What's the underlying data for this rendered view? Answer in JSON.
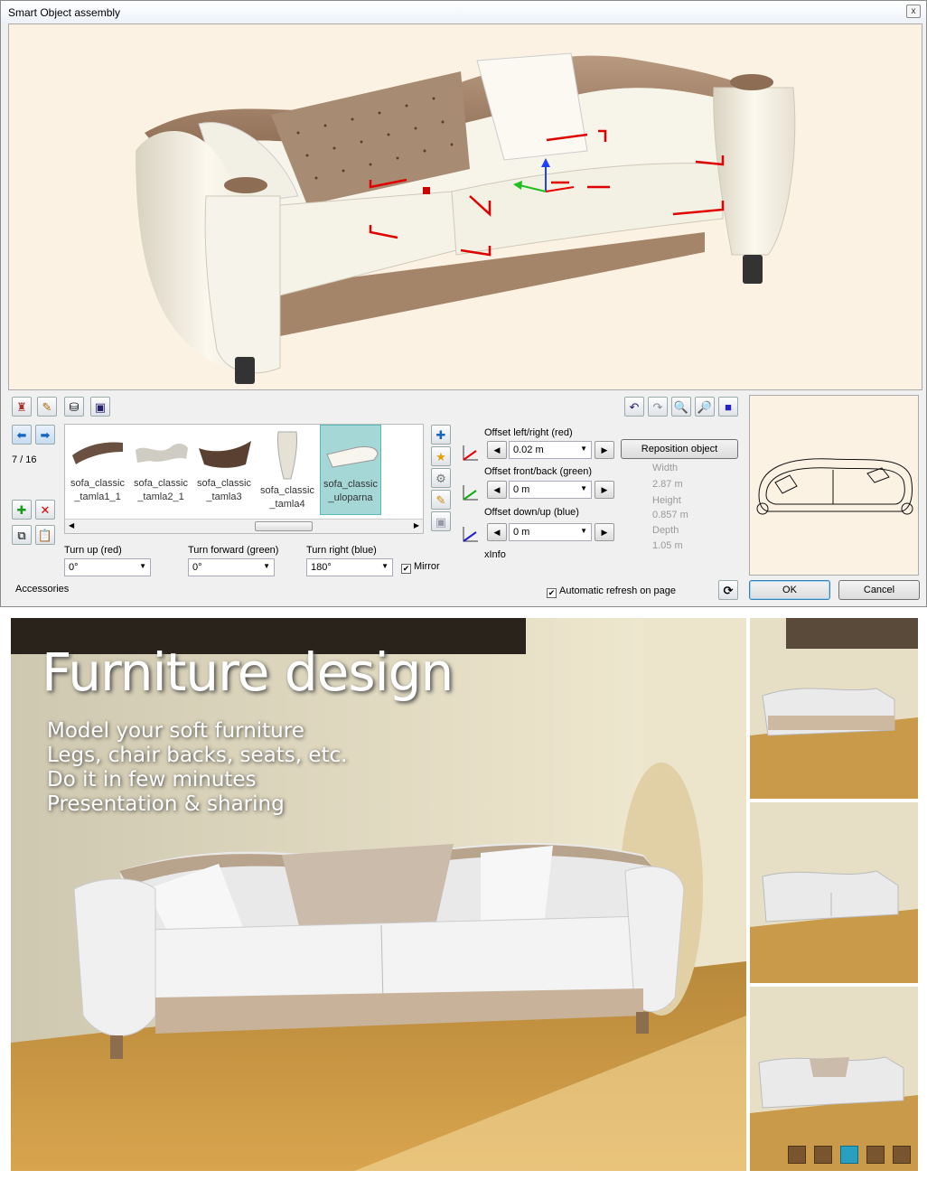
{
  "window": {
    "title": "Smart Object assembly",
    "close": "x"
  },
  "nav": {
    "counter": "7 / 16"
  },
  "library": {
    "items": [
      {
        "label": "sofa_classic _tamla1_1"
      },
      {
        "label": "sofa_classic _tamla2_1"
      },
      {
        "label": "sofa_classic _tamla3"
      },
      {
        "label": "sofa_classic _tamla4"
      },
      {
        "label": "sofa_classic _uloparna"
      }
    ],
    "selected_index": 4
  },
  "rotation": {
    "turn_up_label": "Turn up (red)",
    "turn_up_value": "0°",
    "turn_forward_label": "Turn forward (green)",
    "turn_forward_value": "0°",
    "turn_right_label": "Turn right (blue)",
    "turn_right_value": "180°",
    "mirror_label": "Mirror",
    "mirror_checked": true
  },
  "offsets": {
    "lr_label": "Offset left/right (red)",
    "lr_value": "0.02 m",
    "fb_label": "Offset front/back (green)",
    "fb_value": "0 m",
    "du_label": "Offset down/up (blue)",
    "du_value": "0 m",
    "xinfo": "xInfo"
  },
  "reposition_label": "Reposition object",
  "dims": {
    "width_label": "Width",
    "width_value": "2.87 m",
    "height_label": "Height",
    "height_value": "0.857 m",
    "depth_label": "Depth",
    "depth_value": "1.05 m"
  },
  "footer": {
    "accessories": "Accessories",
    "auto_refresh": "Automatic refresh on page",
    "auto_refresh_checked": true,
    "ok": "OK",
    "cancel": "Cancel"
  },
  "promo": {
    "headline": "Furniture design",
    "bullets": [
      "Model your soft furniture",
      "Legs, chair backs, seats, etc.",
      "Do it in few minutes",
      "Presentation & sharing"
    ],
    "pager_active": 3,
    "pager_count": 5
  },
  "colors": {
    "accent_selection": "#a6d7d7",
    "pager_active": "#2aa0c0",
    "viewport_bg": "#fbf2e3"
  }
}
